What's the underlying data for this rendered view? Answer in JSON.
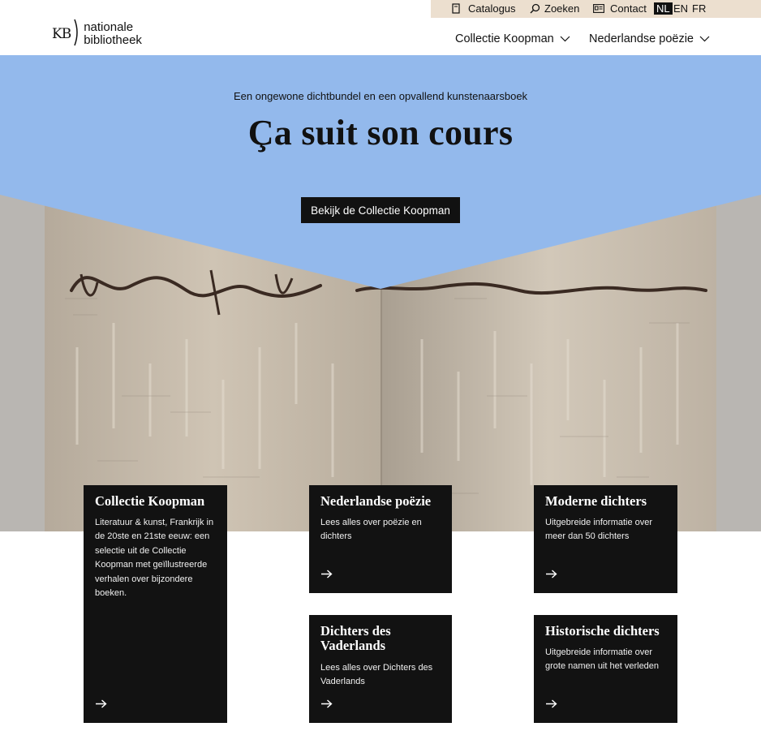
{
  "utility": {
    "catalogus": "Catalogus",
    "zoeken": "Zoeken",
    "contact": "Contact",
    "languages": [
      "NL",
      "EN",
      "FR"
    ]
  },
  "logo": {
    "mark": "KB",
    "line1": "nationale",
    "line2": "bibliotheek"
  },
  "nav": {
    "item1": "Collectie Koopman",
    "item2": "Nederlandse poëzie"
  },
  "hero": {
    "subtitle": "Een ongewone dichtbundel en een opvallend kunstenaarsboek",
    "title": "Ça suit son cours",
    "cta": "Bekijk de Collectie Koopman"
  },
  "cards": [
    {
      "title": "Collectie Koopman",
      "description": "Literatuur & kunst, Frankrijk in de 20ste en 21ste eeuw: een selectie uit de Collectie Koopman met geïllustreerde verhalen over bijzondere boeken."
    },
    {
      "title": "Nederlandse poëzie",
      "description": "Lees alles over poëzie en dichters"
    },
    {
      "title": "Moderne dichters",
      "description": "Uitgebreide informatie over meer dan 50 dichters"
    },
    {
      "title": "Dichters des Vaderlands",
      "description": "Lees alles over Dichters des Vaderlands"
    },
    {
      "title": "Historische dichters",
      "description": "Uitgebreide informatie over grote namen uit het verleden"
    }
  ],
  "colors": {
    "utility_bg": "#ecdfcf",
    "hero_blue": "#93b9ec",
    "card_bg": "#121212"
  }
}
